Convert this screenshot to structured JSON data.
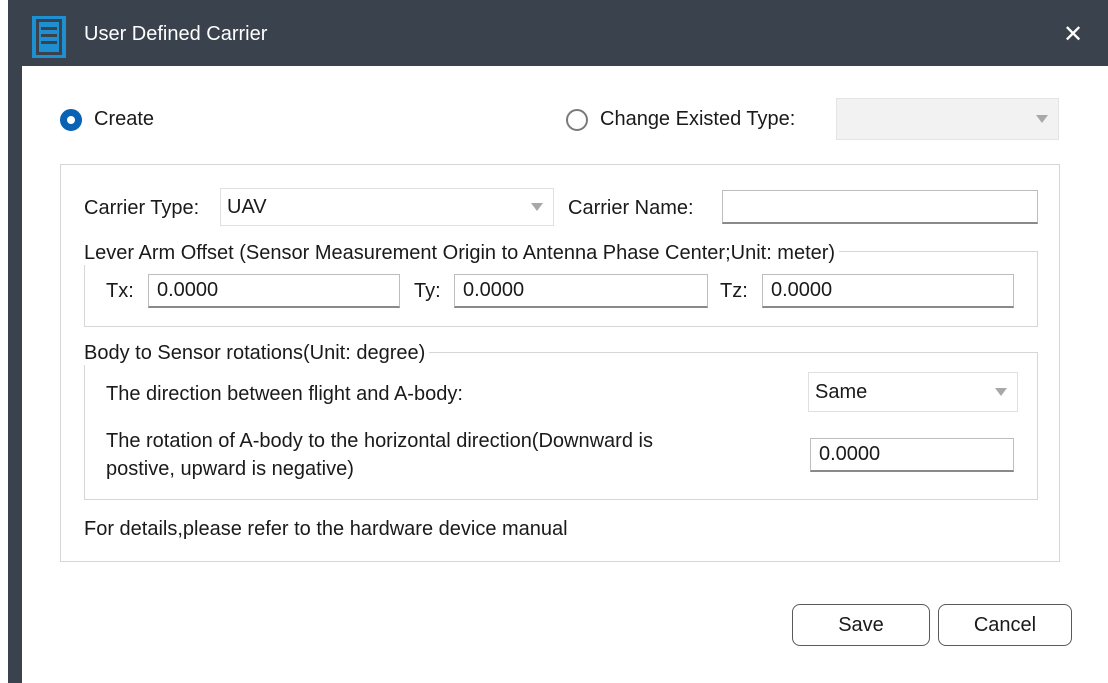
{
  "window": {
    "title": "User Defined Carrier",
    "close_icon": "close-icon",
    "app_icon": "document-icon"
  },
  "mode": {
    "create_label": "Create",
    "create_selected": true,
    "change_label": "Change Existed Type:",
    "change_selected": false,
    "change_type_value": ""
  },
  "carrier": {
    "type_label": "Carrier Type:",
    "type_value": "UAV",
    "name_label": "Carrier Name:",
    "name_value": ""
  },
  "lever_arm": {
    "legend": "Lever Arm Offset (Sensor Measurement Origin to Antenna Phase Center;Unit: meter)",
    "tx_label": "Tx:",
    "tx_value": "0.0000",
    "ty_label": "Ty:",
    "ty_value": "0.0000",
    "tz_label": "Tz:",
    "tz_value": "0.0000"
  },
  "rotation": {
    "legend": "Body to Sensor rotations(Unit: degree)",
    "direction_label": "The direction between flight and A-body:",
    "direction_value": "Same",
    "rotation_label_line1": "The rotation of A-body to the horizontal direction(Downward is",
    "rotation_label_line2": "postive, upward is negative)",
    "rotation_value": "0.0000"
  },
  "note": "For details,please refer to the hardware device manual",
  "buttons": {
    "save_label": "Save",
    "cancel_label": "Cancel"
  },
  "colors": {
    "titlebar": "#3a424d",
    "accent": "#0a62b4",
    "icon": "#1e8fd0"
  }
}
